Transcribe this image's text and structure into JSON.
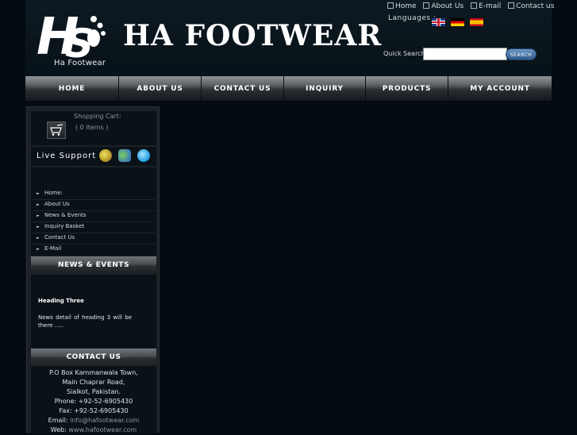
{
  "header": {
    "logo_subtext": "Ha Footwear",
    "brand_title": "HA FOOTWEAR",
    "top_links": [
      "Home",
      "About Us",
      "E-mail",
      "Contact us"
    ],
    "languages_label": "Languages :",
    "quick_search_label": "Quick Search",
    "search_value": "",
    "search_button": "SEARCH"
  },
  "nav": {
    "items": [
      "HOME",
      "ABOUT US",
      "CONTACT US",
      "INQUIRY",
      "PRODUCTS",
      "MY ACCOUNT"
    ]
  },
  "sidebar": {
    "cart_title": "Shopping Cart:",
    "cart_count": "( 0 Items )",
    "live_support_label": "Live Support :",
    "links": [
      "Home:",
      "About Us",
      "News & Events",
      "Inquiry Basket",
      "Contact Us",
      "E-Mail"
    ],
    "news_heading": "NEWS & EVENTS",
    "news_item_title": "Heading Three",
    "news_item_text": "News detail of heading 3 will be there .....",
    "contact_heading": "CONTACT US",
    "contact_lines": [
      "P.O Box Kammanwala Town,",
      "Main Chaprar Road,",
      "Sialkot, Pakistan.",
      "Phone: +92-52-6905430",
      "Fax: +92-52-6905430"
    ],
    "email_label": "Email:",
    "email_value": "info@hafootwear.com",
    "web_label": "Web:",
    "web_value": "www.hafootwear.com"
  },
  "colors": {
    "background": "#050b12",
    "search_button": "#2c5a8c",
    "panel": "#0a1218"
  }
}
